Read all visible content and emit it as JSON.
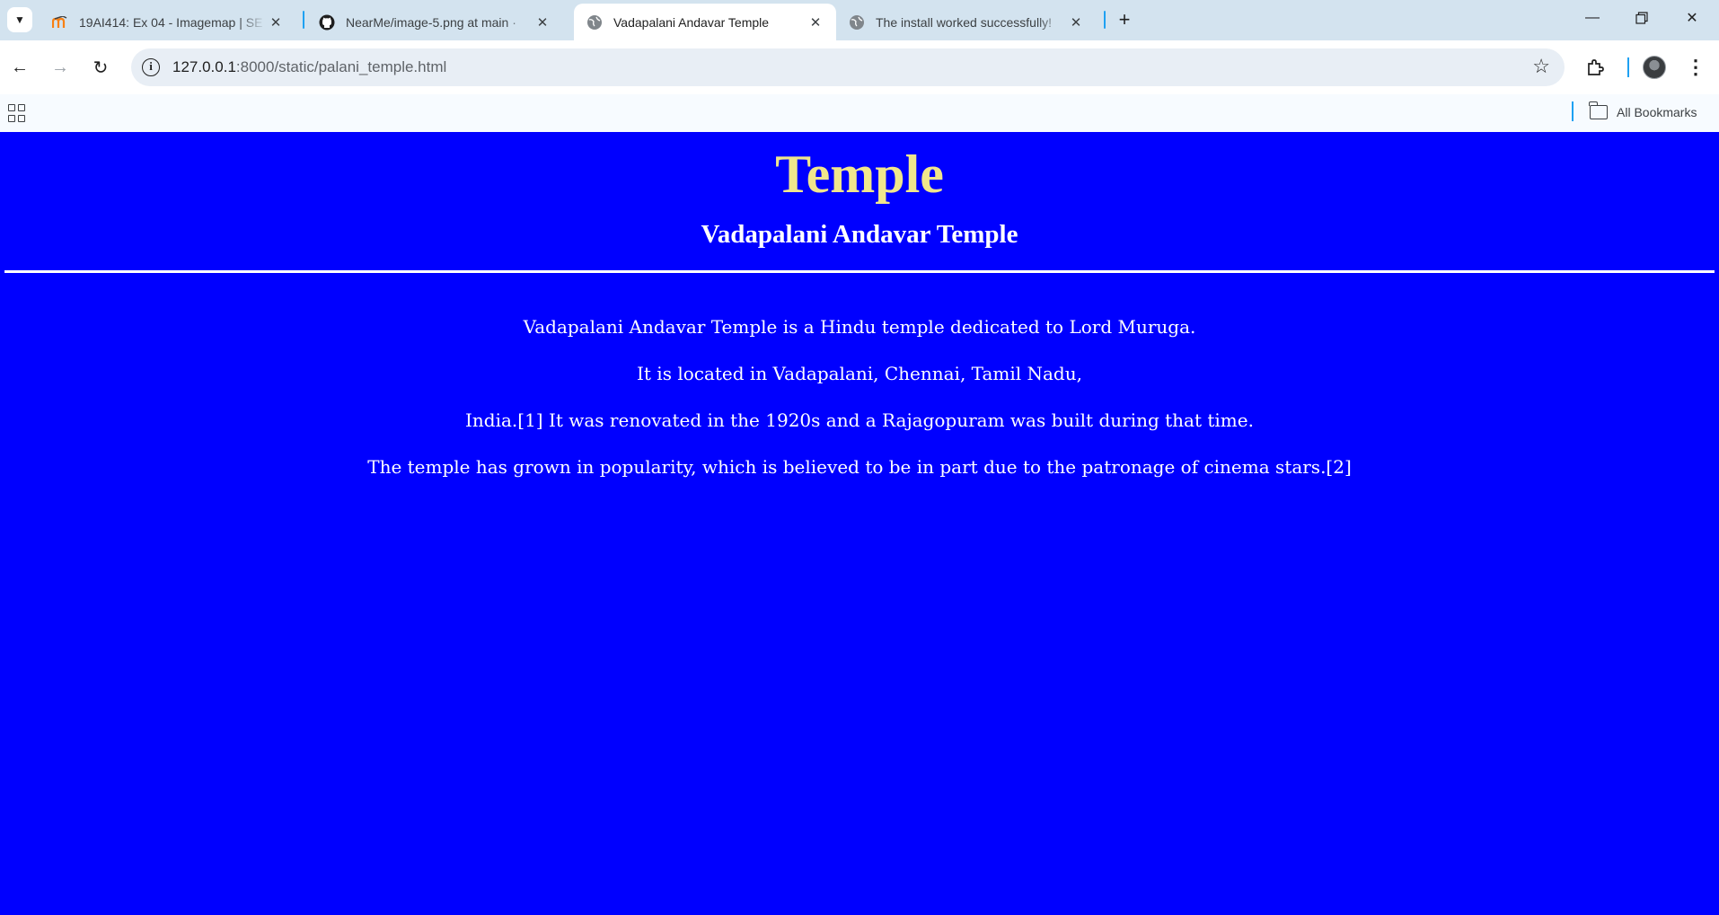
{
  "browser": {
    "tabs": [
      {
        "title": "19AI414: Ex 04 - Imagemap | SE",
        "icon": "moodle-icon",
        "active": false
      },
      {
        "title": "NearMe/image-5.png at main ·",
        "icon": "github-icon",
        "active": false
      },
      {
        "title": "Vadapalani Andavar Temple",
        "icon": "globe-icon",
        "active": true
      },
      {
        "title": "The install worked successfully!",
        "icon": "globe-icon",
        "active": false
      }
    ],
    "url_host": "127.0.0.1",
    "url_rest": ":8000/static/palani_temple.html",
    "bookmarks_label": "All Bookmarks"
  },
  "page": {
    "heading": "Temple",
    "subheading": "Vadapalani Andavar Temple",
    "paragraphs": [
      "Vadapalani Andavar Temple is a Hindu temple dedicated to Lord Muruga.",
      "It is located in Vadapalani, Chennai, Tamil Nadu,",
      "India.[1] It was renovated in the 1920s and a Rajagopuram was built during that time.",
      "The temple has grown in popularity, which is believed to be in part due to the patronage of cinema stars.[2]"
    ]
  },
  "colors": {
    "page_background": "#0000ff",
    "heading_color": "#f0e68c",
    "text_color": "#ffffff"
  }
}
